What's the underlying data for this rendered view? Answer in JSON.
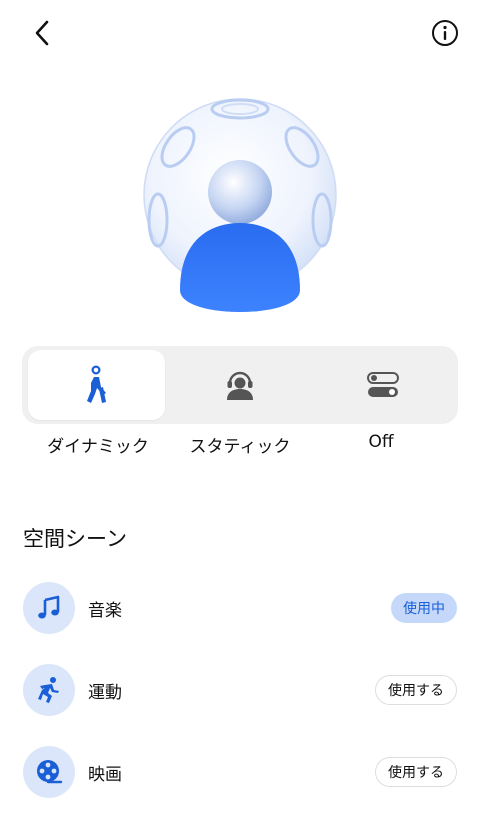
{
  "header": {
    "back_icon": "chevron-left-icon",
    "info_icon": "info-circle-icon"
  },
  "modes": [
    {
      "label": "ダイナミック",
      "icon": "walking-person-icon",
      "active": true
    },
    {
      "label": "スタティック",
      "icon": "headphone-person-icon",
      "active": false
    },
    {
      "label": "Off",
      "icon": "toggle-switches-icon",
      "active": false
    }
  ],
  "section": {
    "title": "空間シーン"
  },
  "scenes": [
    {
      "label": "音楽",
      "icon": "music-note-icon",
      "status": "使用中",
      "in_use": true
    },
    {
      "label": "運動",
      "icon": "running-person-icon",
      "status": "使用する",
      "in_use": false
    },
    {
      "label": "映画",
      "icon": "film-reel-icon",
      "status": "使用する",
      "in_use": false
    }
  ],
  "colors": {
    "accent": "#1a5fd6",
    "accent_light": "#dce6fb",
    "pill_active": "#c5d8fa"
  }
}
